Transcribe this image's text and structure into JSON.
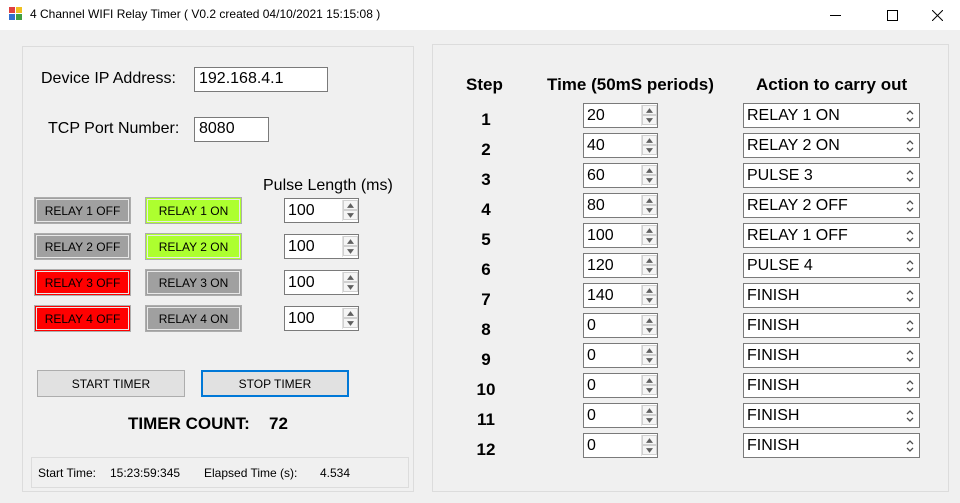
{
  "window": {
    "title": "4 Channel WIFI Relay Timer ( V0.2 created 04/10/2021 15:15:08 )",
    "icon": "app-grid-icon",
    "controls": [
      "minimize-icon",
      "maximize-icon",
      "close-icon"
    ]
  },
  "connection": {
    "ip_label": "Device IP Address:",
    "ip_value": "192.168.4.1",
    "port_label": "TCP Port Number:",
    "port_value": "8080"
  },
  "relays": {
    "pulse_header": "Pulse Length (ms)",
    "rows": [
      {
        "off_label": "RELAY 1 OFF",
        "off_color": "#a0a0a0",
        "on_label": "RELAY 1 ON",
        "on_color": "#adff2f",
        "pulse": "100"
      },
      {
        "off_label": "RELAY 2 OFF",
        "off_color": "#a0a0a0",
        "on_label": "RELAY 2 ON",
        "on_color": "#adff2f",
        "pulse": "100"
      },
      {
        "off_label": "RELAY 3 OFF",
        "off_color": "#ff0000",
        "on_label": "RELAY 3 ON",
        "on_color": "#a0a0a0",
        "pulse": "100"
      },
      {
        "off_label": "RELAY 4 OFF",
        "off_color": "#ff0000",
        "on_label": "RELAY 4 ON",
        "on_color": "#a0a0a0",
        "pulse": "100"
      }
    ]
  },
  "timer": {
    "start_label": "START TIMER",
    "stop_label": "STOP TIMER",
    "count_label": "TIMER COUNT:",
    "count_value": "72",
    "accent": "#0078d7"
  },
  "status": {
    "start_time_label": "Start Time:",
    "start_time_value": "15:23:59:345",
    "elapsed_label": "Elapsed Time (s):",
    "elapsed_value": "4.534"
  },
  "sequence": {
    "headers": {
      "step": "Step",
      "time": "Time (50mS periods)",
      "action": "Action to carry out"
    },
    "steps": [
      {
        "num": "1",
        "time": "20",
        "action": "RELAY 1 ON"
      },
      {
        "num": "2",
        "time": "40",
        "action": "RELAY 2 ON"
      },
      {
        "num": "3",
        "time": "60",
        "action": "PULSE 3"
      },
      {
        "num": "4",
        "time": "80",
        "action": "RELAY 2 OFF"
      },
      {
        "num": "5",
        "time": "100",
        "action": "RELAY 1 OFF"
      },
      {
        "num": "6",
        "time": "120",
        "action": "PULSE 4"
      },
      {
        "num": "7",
        "time": "140",
        "action": "FINISH"
      },
      {
        "num": "8",
        "time": "0",
        "action": "FINISH"
      },
      {
        "num": "9",
        "time": "0",
        "action": "FINISH"
      },
      {
        "num": "10",
        "time": "0",
        "action": "FINISH"
      },
      {
        "num": "11",
        "time": "0",
        "action": "FINISH"
      },
      {
        "num": "12",
        "time": "0",
        "action": "FINISH"
      }
    ]
  }
}
